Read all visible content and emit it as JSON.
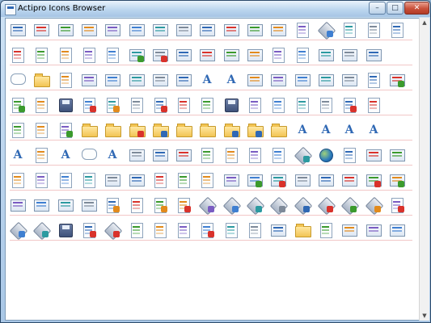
{
  "window": {
    "title": "Actipro Icons Browser",
    "controls": {
      "minimize": "–",
      "maximize": "□",
      "close": "✕"
    }
  },
  "scrollbar": {
    "up": "▲",
    "down": "▼"
  },
  "colors": {
    "accent": "#2f68b4",
    "red": "#d9322b",
    "green": "#3b9a2d",
    "orange": "#e28a1c",
    "yellow": "#f2c453",
    "purple": "#7a5cc2",
    "blue": "#3f7fd1",
    "teal": "#2c9aa0",
    "gray": "#7e8a99"
  },
  "icon_grid": {
    "rows": [
      [
        "table-icon",
        "table-export-icon",
        "table-import-icon",
        "table-1-icon",
        "table-2-icon",
        "table-3-icon",
        "table-4-icon",
        "table-5-icon",
        "table-6-icon",
        "table-7-icon",
        "table-8-icon",
        "table-9-icon",
        "gradient-icon",
        "toolbox-icon",
        "insert-row-below-icon",
        "insert-row-above-icon",
        "row-icon"
      ],
      [
        "layers-icon",
        "document-chart-icon",
        "document-refresh-icon",
        "document-green-icon",
        "clapperboard-icon",
        "table-add-icon",
        "table-delete-icon",
        "table-edit-icon",
        "table-properties-icon",
        "table-text-icon",
        "table-heading-icon",
        "color-stripes-icon",
        "gray-scale-icon",
        "colored-grid-icon",
        "image-grid-icon",
        "blue-panel-icon"
      ],
      [
        "speech-bubble-icon",
        "undo-folder-icon",
        "check-icon",
        "text-box-icon",
        "checkbox-icon",
        "list-box-icon",
        "label-box-icon",
        "dotted-box-icon",
        "text-label-icon",
        "font-aa-icon",
        "combo-icon",
        "password-icon",
        "radio-icon",
        "calculator-icon",
        "money-icon",
        "print-preview-icon",
        "money-add-icon"
      ],
      [
        "new-document-icon",
        "document-plain-icon",
        "document-disk-icon",
        "document-delete-icon",
        "document-edit-icon",
        "document-blank-icon",
        "document-red-icon",
        "document-text-icon",
        "document-fold-icon",
        "save-icon",
        "binoculars-icon",
        "document-copy-icon",
        "sticky-note-icon",
        "cabinet-icon",
        "warning-document-icon",
        "photo-document-icon"
      ],
      [
        "flash-icon",
        "tree-icon",
        "tree-add-icon",
        "folder-icon",
        "folder-open-icon",
        "folder-delete-icon",
        "folder-edit-icon",
        "folder-plain-icon",
        "folder-open-2-icon",
        "folder-check-icon",
        "folder-search-icon",
        "folder-3-icon",
        "font-grow-icon",
        "font-shrink-icon",
        "font-size-icon",
        "font-letter-icon"
      ],
      [
        "font-a-icon",
        "link-icon",
        "align-text-icon",
        "comment-text-icon",
        "page-a-icon",
        "list-icon",
        "table-small-icon",
        "image-frame-icon",
        "image-select-icon",
        "crop-icon",
        "split-icon",
        "code-icon",
        "search-tool-icon",
        "globe-icon",
        "chart-line-icon",
        "window-list-icon",
        "numbered-list-icon"
      ],
      [
        "copy-icon",
        "paste-icon",
        "document-lines-icon",
        "document-lines-2-icon",
        "document-table-icon",
        "calculator-2-icon",
        "zoom-glass-icon",
        "paste-2-icon",
        "network-icon",
        "window-pin-icon",
        "window-add-icon",
        "window-delete-icon",
        "window-edit-icon",
        "window-plain-icon",
        "user-window-icon",
        "window-remove-icon",
        "window-add-2-icon"
      ],
      [
        "user-panel-icon",
        "users-window-icon",
        "edit-window-icon",
        "edit-window-2-icon",
        "edit-arrow-icon",
        "arrow-right-icon",
        "edit-check-icon",
        "edit-delete-icon",
        "hammer-icon",
        "tool-add-icon",
        "tool-delete-icon",
        "tool-edit-icon",
        "tool-check-icon",
        "tool-paint-icon",
        "tool-power-icon",
        "tool-cut-icon",
        "stop-red-icon"
      ],
      [
        "tool-flag-icon",
        "pointer-tool-icon",
        "printer-icon",
        "red-strip-icon",
        "tool-key-icon",
        "binoculars-2-icon",
        "cube-stack-icon",
        "zoom-doc-icon",
        "close-doc-icon",
        "battery-icon",
        "clock-icon",
        "props-window-icon",
        "folder-arrow-icon",
        "glasses-icon",
        "form-window-icon",
        "media-player-icon",
        "zoom-window-icon"
      ]
    ]
  }
}
